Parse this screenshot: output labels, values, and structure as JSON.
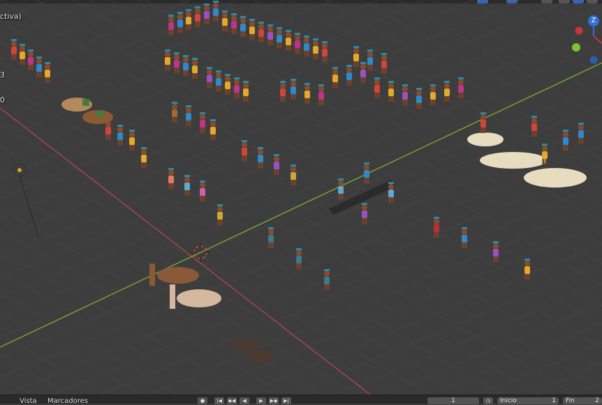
{
  "viewport": {
    "mode_label": "ctiva)",
    "stat_a": "3",
    "stat_b": "0"
  },
  "gizmo": {
    "z_label": "Z"
  },
  "footer": {
    "menu_vista": "Vista",
    "menu_marcadores": "Marcadores",
    "current_frame": "1",
    "start_label": "Inicio",
    "start_value": "1",
    "end_label": "Fin",
    "end_value": "2"
  },
  "colors": {
    "axis_x": "#b0434d",
    "axis_y": "#7aa732",
    "gizmo_z": "#2f6fd6",
    "gizmo_x": "#c8343f",
    "gizmo_y": "#7ac72b"
  }
}
